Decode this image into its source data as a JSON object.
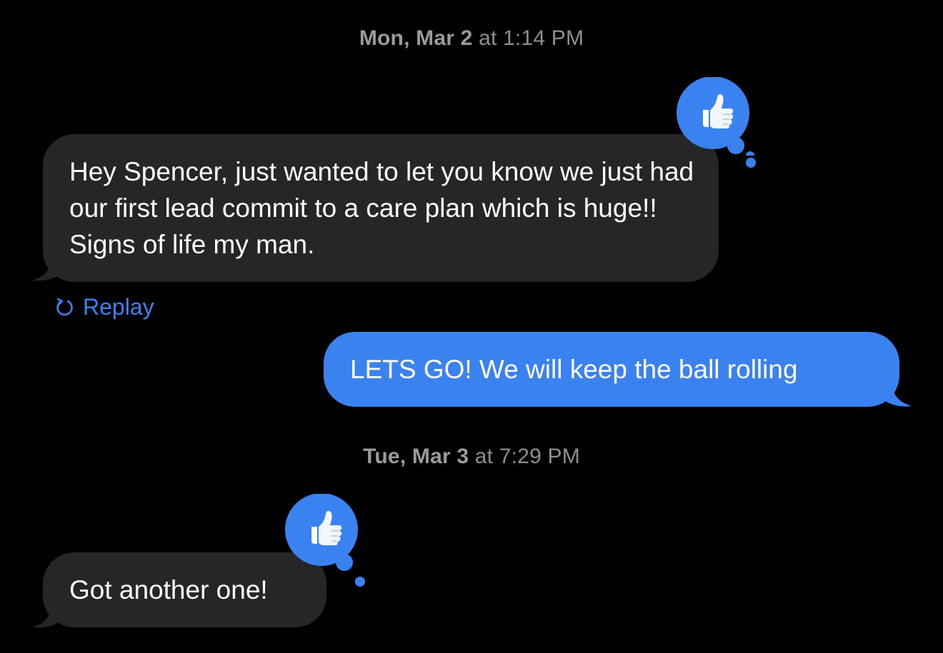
{
  "conversation": {
    "timestamp_1": {
      "day": "Mon, Mar 2",
      "sep": " at ",
      "time": "1:14 PM"
    },
    "timestamp_2": {
      "day": "Tue, Mar 3",
      "sep": " at ",
      "time": "7:29 PM"
    },
    "messages": [
      {
        "direction": "received",
        "text": "Hey Spencer, just wanted to let you know we just had our first lead commit to a care plan which is huge!! Signs of life my man.",
        "reaction": "thumbs-up"
      },
      {
        "direction": "sent",
        "text": "LETS GO! We will keep the ball rolling"
      },
      {
        "direction": "received",
        "text": "Got another one!",
        "reaction": "thumbs-up"
      }
    ],
    "replay_label": "Replay"
  },
  "colors": {
    "background": "#000000",
    "received_bubble": "#262628",
    "sent_bubble": "#3b82f1",
    "accent": "#3b82f1",
    "timestamp_text": "#8e8e93"
  },
  "icons": {
    "reaction": "thumbs-up-icon",
    "replay": "replay-arrow-icon"
  }
}
